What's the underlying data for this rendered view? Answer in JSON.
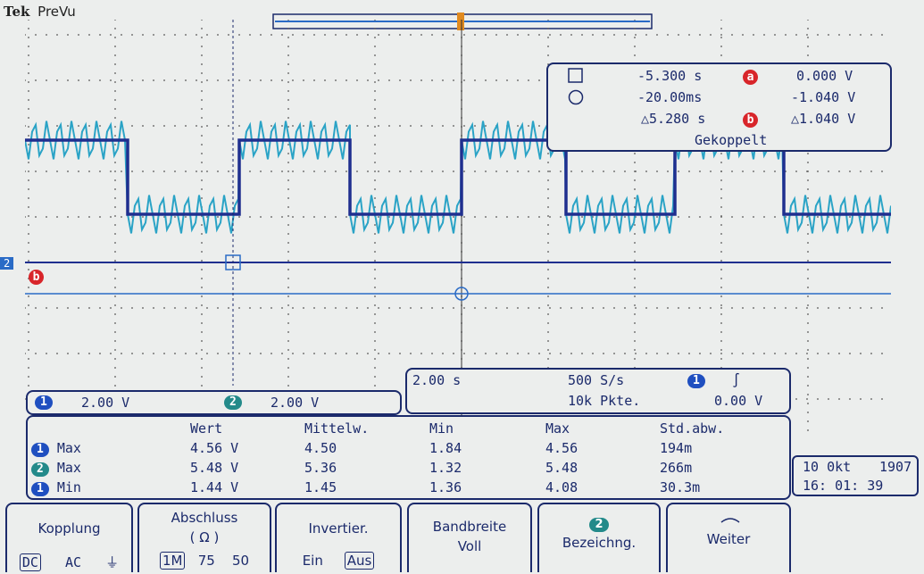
{
  "header": {
    "brand": "Tek",
    "mode": "PreVu"
  },
  "markers": {
    "ch2": "2",
    "cursor_b": "b"
  },
  "cursor": {
    "square_time": "-5.300 s",
    "square_marker": "a",
    "square_volt": "0.000 V",
    "circle_time": "-20.00ms",
    "circle_volt": "-1.040 V",
    "delta_time": "△5.280 s",
    "delta_marker": "b",
    "delta_volt": "△1.040 V",
    "mode": "Gekoppelt"
  },
  "channels": {
    "ch1_num": "1",
    "ch1_scale": "2.00 V",
    "ch2_num": "2",
    "ch2_scale": "2.00 V"
  },
  "timebase": {
    "time_div": "2.00 s",
    "sample_rate": "500 S/s",
    "record_length": "10k Pkte.",
    "trigger_ch": "1",
    "trigger_slope": "∫",
    "trigger_level": "0.00 V"
  },
  "measurements": {
    "headers": [
      "Wert",
      "Mittelw.",
      "Min",
      "Max",
      "Std.abw."
    ],
    "rows": [
      {
        "ch": "1",
        "label": "Max",
        "values": [
          "4.56 V",
          "4.50",
          "1.84",
          "4.56",
          "194m"
        ]
      },
      {
        "ch": "2",
        "label": "Max",
        "values": [
          "5.48 V",
          "5.36",
          "1.32",
          "5.48",
          "266m"
        ]
      },
      {
        "ch": "1",
        "label": "Min",
        "values": [
          "1.44 V",
          "1.45",
          "1.36",
          "4.08",
          "30.3m"
        ]
      }
    ]
  },
  "datetime": {
    "date": "10 0kt",
    "year": "1907",
    "time": "16: 01: 39"
  },
  "softkeys": {
    "kopplung": {
      "title": "Kopplung",
      "opt1": "DC",
      "opt2": "AC",
      "opt3": "⏚"
    },
    "abschluss": {
      "title": "Abschluss",
      "unit": "( Ω )",
      "opt1": "1M",
      "opt2": "75",
      "opt3": "50"
    },
    "invertier": {
      "title": "Invertier.",
      "opt1": "Ein",
      "opt2": "Aus"
    },
    "bandbreite": {
      "title": "Bandbreite",
      "value": "Voll"
    },
    "bezeichnung": {
      "badge": "2",
      "title": "Bezeichng."
    },
    "weiter": {
      "title": "Weiter"
    }
  },
  "colors": {
    "ch1": "#1f2f8f",
    "ch2": "#2aa3c6",
    "text": "#1b2a6b",
    "marker_red": "#d8252a"
  }
}
